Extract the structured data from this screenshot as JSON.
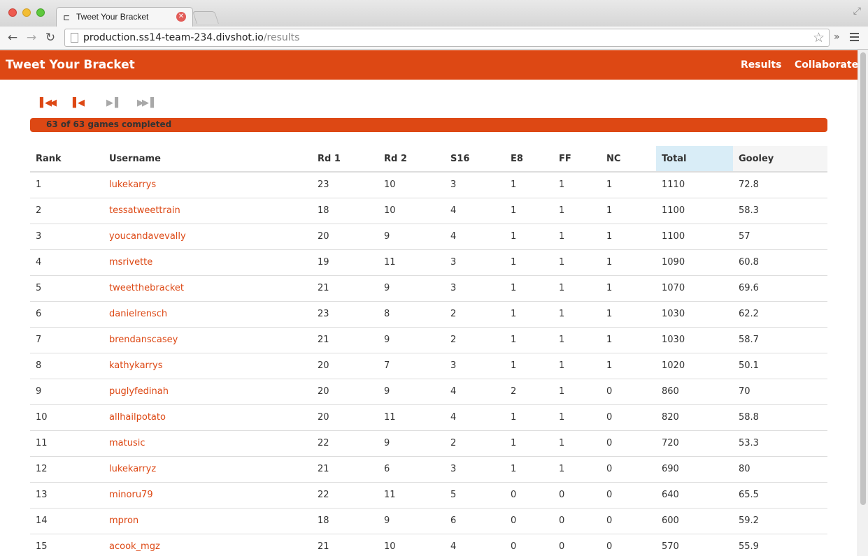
{
  "browser": {
    "tab_title": "Tweet Your Bracket",
    "url_host": "production.ss14-team-234.divshot.io",
    "url_path": "/results",
    "ext_chevron": "»"
  },
  "navbar": {
    "brand": "Tweet Your Bracket",
    "links": [
      "Results",
      "Collaborate"
    ],
    "color": "#dd4814"
  },
  "pager": {
    "icons": [
      "first-icon",
      "prev-icon",
      "next-icon",
      "last-icon"
    ],
    "enabled": [
      true,
      true,
      false,
      false
    ]
  },
  "progress": {
    "label": "63 of 63 games completed",
    "completed": 63,
    "total": 63
  },
  "table": {
    "headers": [
      "Rank",
      "Username",
      "Rd 1",
      "Rd 2",
      "S16",
      "E8",
      "FF",
      "NC",
      "Total",
      "Gooley"
    ],
    "rows": [
      [
        "1",
        "lukekarrys",
        "23",
        "10",
        "3",
        "1",
        "1",
        "1",
        "1110",
        "72.8"
      ],
      [
        "2",
        "tessatweettrain",
        "18",
        "10",
        "4",
        "1",
        "1",
        "1",
        "1100",
        "58.3"
      ],
      [
        "3",
        "youcandavevally",
        "20",
        "9",
        "4",
        "1",
        "1",
        "1",
        "1100",
        "57"
      ],
      [
        "4",
        "msrivette",
        "19",
        "11",
        "3",
        "1",
        "1",
        "1",
        "1090",
        "60.8"
      ],
      [
        "5",
        "tweetthebracket",
        "21",
        "9",
        "3",
        "1",
        "1",
        "1",
        "1070",
        "69.6"
      ],
      [
        "6",
        "danielrensch",
        "23",
        "8",
        "2",
        "1",
        "1",
        "1",
        "1030",
        "62.2"
      ],
      [
        "7",
        "brendanscasey",
        "21",
        "9",
        "2",
        "1",
        "1",
        "1",
        "1030",
        "58.7"
      ],
      [
        "8",
        "kathykarrys",
        "20",
        "7",
        "3",
        "1",
        "1",
        "1",
        "1020",
        "50.1"
      ],
      [
        "9",
        "puglyfedinah",
        "20",
        "9",
        "4",
        "2",
        "1",
        "0",
        "860",
        "70"
      ],
      [
        "10",
        "allhailpotato",
        "20",
        "11",
        "4",
        "1",
        "1",
        "0",
        "820",
        "58.8"
      ],
      [
        "11",
        "matusic",
        "22",
        "9",
        "2",
        "1",
        "1",
        "0",
        "720",
        "53.3"
      ],
      [
        "12",
        "lukekarryz",
        "21",
        "6",
        "3",
        "1",
        "1",
        "0",
        "690",
        "80"
      ],
      [
        "13",
        "minoru79",
        "22",
        "11",
        "5",
        "0",
        "0",
        "0",
        "640",
        "65.5"
      ],
      [
        "14",
        "mpron",
        "18",
        "9",
        "6",
        "0",
        "0",
        "0",
        "600",
        "59.2"
      ],
      [
        "15",
        "acook_mgz",
        "21",
        "10",
        "4",
        "0",
        "0",
        "0",
        "570",
        "55.9"
      ]
    ]
  }
}
